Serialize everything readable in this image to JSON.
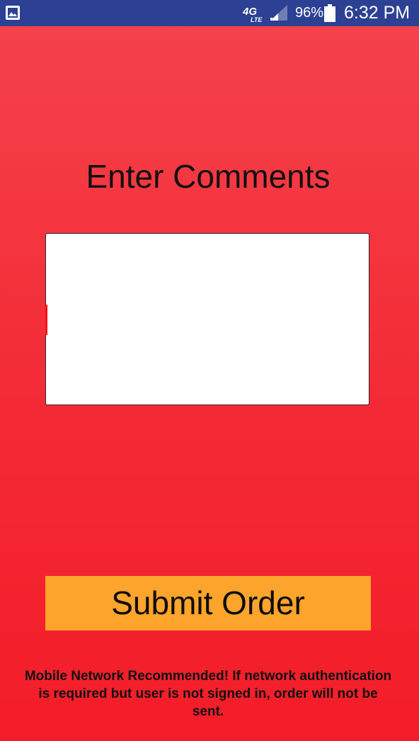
{
  "status_bar": {
    "network_label": "4G",
    "network_sub_label": "LTE",
    "battery_percent": "96%",
    "time": "6:32 PM",
    "icons": [
      "gallery-icon",
      "lte-icon",
      "signal-icon",
      "battery-icon"
    ],
    "background_color": "#2c4193"
  },
  "main": {
    "heading": "Enter Comments",
    "comments_value": "",
    "submit_label": "Submit Order",
    "notice": "Mobile Network Recommended! If network authentication is required but user is not signed in, order will not be sent."
  },
  "colors": {
    "background_top": "#f4434c",
    "background_bottom": "#f31d29",
    "button": "#fca42b",
    "text": "#111111"
  }
}
